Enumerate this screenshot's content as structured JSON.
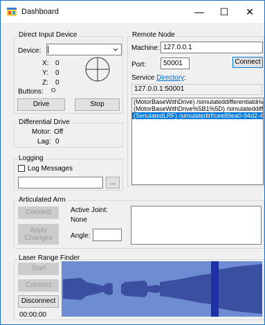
{
  "window": {
    "title": "Dashboard",
    "minimize": "—",
    "maximize": "☐",
    "close": "✕"
  },
  "direct_input": {
    "group_label": "Direct Input Device",
    "device_label": "Device:",
    "device_value": "",
    "x_label": "X:",
    "x_value": "0",
    "y_label": "Y:",
    "y_value": "0",
    "z_label": "Z:",
    "z_value": "0",
    "buttons_label": "Buttons:",
    "buttons_value": "O",
    "drive_button": "Drive",
    "stop_button": "Stop"
  },
  "differential_drive": {
    "group_label": "Differential Drive",
    "motor_label": "Motor:",
    "motor_value": "Off",
    "lag_label": "Lag:",
    "lag_value": "0"
  },
  "logging": {
    "group_label": "Logging",
    "log_messages_label": "Log Messages",
    "log_file_value": "",
    "browse_button": "..."
  },
  "remote_node": {
    "group_label": "Remote Node",
    "machine_label": "Machine:",
    "machine_value": "127.0.0.1",
    "port_label": "Port:",
    "port_value": "50001",
    "connect_button": "Connect",
    "service_label": "Service",
    "directory_link": "Directory",
    "directory_colon": ":",
    "service_address": "127.0.0.1:50001",
    "services": [
      {
        "text": "(MotorBaseWithDrive) /simulateddifferentialdrive/",
        "selected": false
      },
      {
        "text": "(MotorBaseWithDrive%5B1%5D) /simulateddiffere",
        "selected": false
      },
      {
        "text": "(SimulatedLRF) /simulatedlrf/cee89ea0-94d2-41f",
        "selected": true
      }
    ]
  },
  "articulated_arm": {
    "group_label": "Articulated Arm",
    "connect_button": "Connect",
    "apply_line1": "Apply",
    "apply_line2": "Changes",
    "active_joint_label": "Active Joint:",
    "active_joint_value": "None",
    "angle_label": "Angle:",
    "angle_value": ""
  },
  "laser_range_finder": {
    "group_label": "Laser Range Finder",
    "start_button": "Start",
    "connect_button": "Connect",
    "disconnect_button": "Disconnect",
    "elapsed": "00:00:00",
    "scan_background": "#6e8cd2",
    "scan_fill": "#3a4fa0",
    "scan_highlight": "#1f2fa8"
  }
}
